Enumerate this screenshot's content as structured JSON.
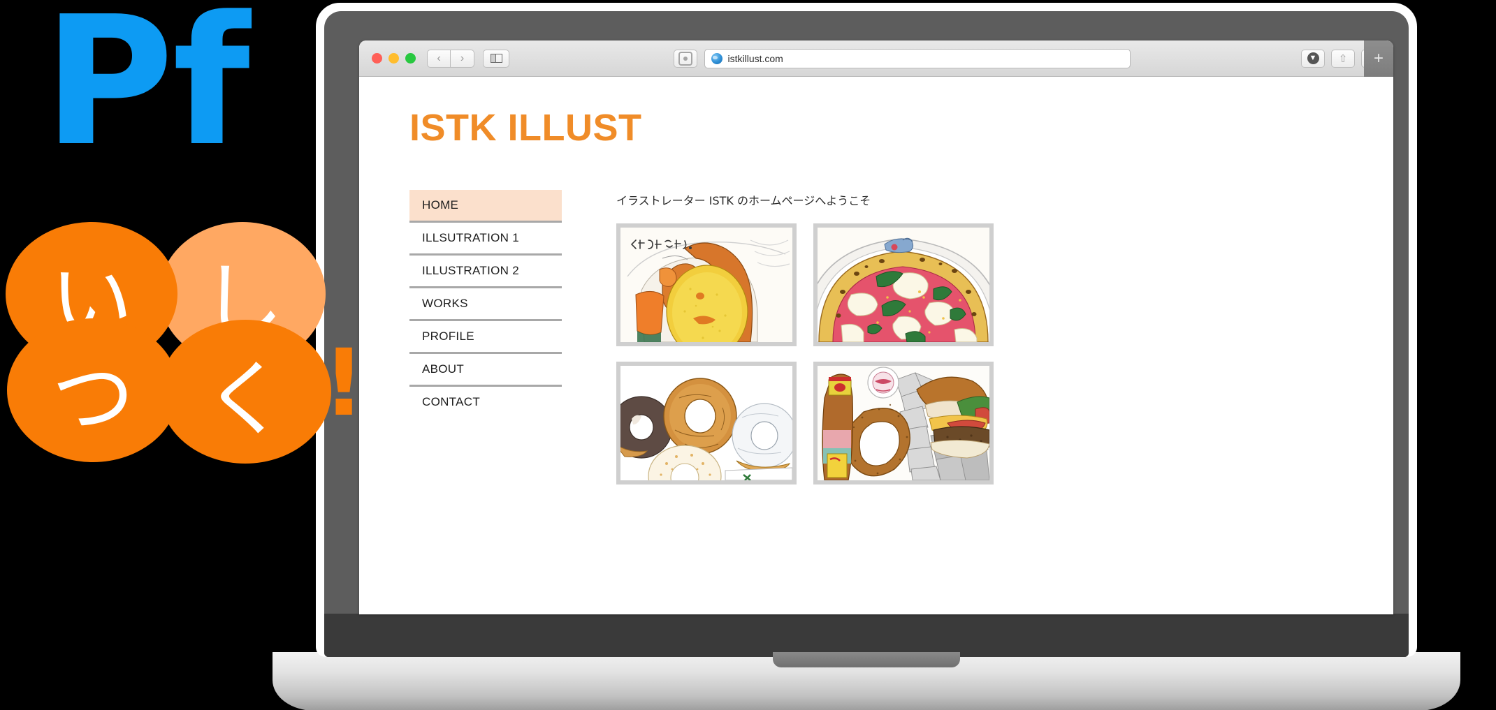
{
  "logo": {
    "pf": "Pf",
    "bubbles": [
      {
        "char": "い",
        "color": "#F97C06"
      },
      {
        "char": "し",
        "color": "#FFA862"
      },
      {
        "char": "つ",
        "color": "#F97C06"
      },
      {
        "char": "く",
        "color": "#F97C06"
      }
    ],
    "exclamation": "!"
  },
  "browser": {
    "traffic_lights": [
      "close-red",
      "minimize-yellow",
      "zoom-green"
    ],
    "back_label": "‹",
    "forward_label": "›",
    "sidebar_icon": "sidebar-icon",
    "reader_icon": "reader-icon",
    "url": "istkillust.com",
    "favicon": "globe-icon",
    "download_icon": "download-icon",
    "share_icon": "share-icon",
    "tabs_icon": "tab-overview-icon",
    "new_tab_label": "+"
  },
  "site": {
    "title": "ISTK ILLUST",
    "welcome": "イラストレーター ISTK のホームページへようこそ",
    "accent_color": "#F08C28",
    "active_nav_bg": "#FBE0CC",
    "nav": [
      {
        "label": "HOME",
        "active": true
      },
      {
        "label": "ILLSUTRATION 1",
        "active": false
      },
      {
        "label": "ILLUSTRATION 2",
        "active": false
      },
      {
        "label": "WORKS",
        "active": false
      },
      {
        "label": "PROFILE",
        "active": false
      },
      {
        "label": "ABOUT",
        "active": false
      },
      {
        "label": "CONTACT",
        "active": false
      }
    ],
    "gallery": [
      {
        "name": "omurice-pumpkin-illustration",
        "caption": "またカぼちゃだわ。"
      },
      {
        "name": "margherita-pizza-illustration",
        "caption": ""
      },
      {
        "name": "donuts-illustration",
        "caption": ""
      },
      {
        "name": "burger-onion-ring-illustration",
        "caption": ""
      }
    ]
  }
}
